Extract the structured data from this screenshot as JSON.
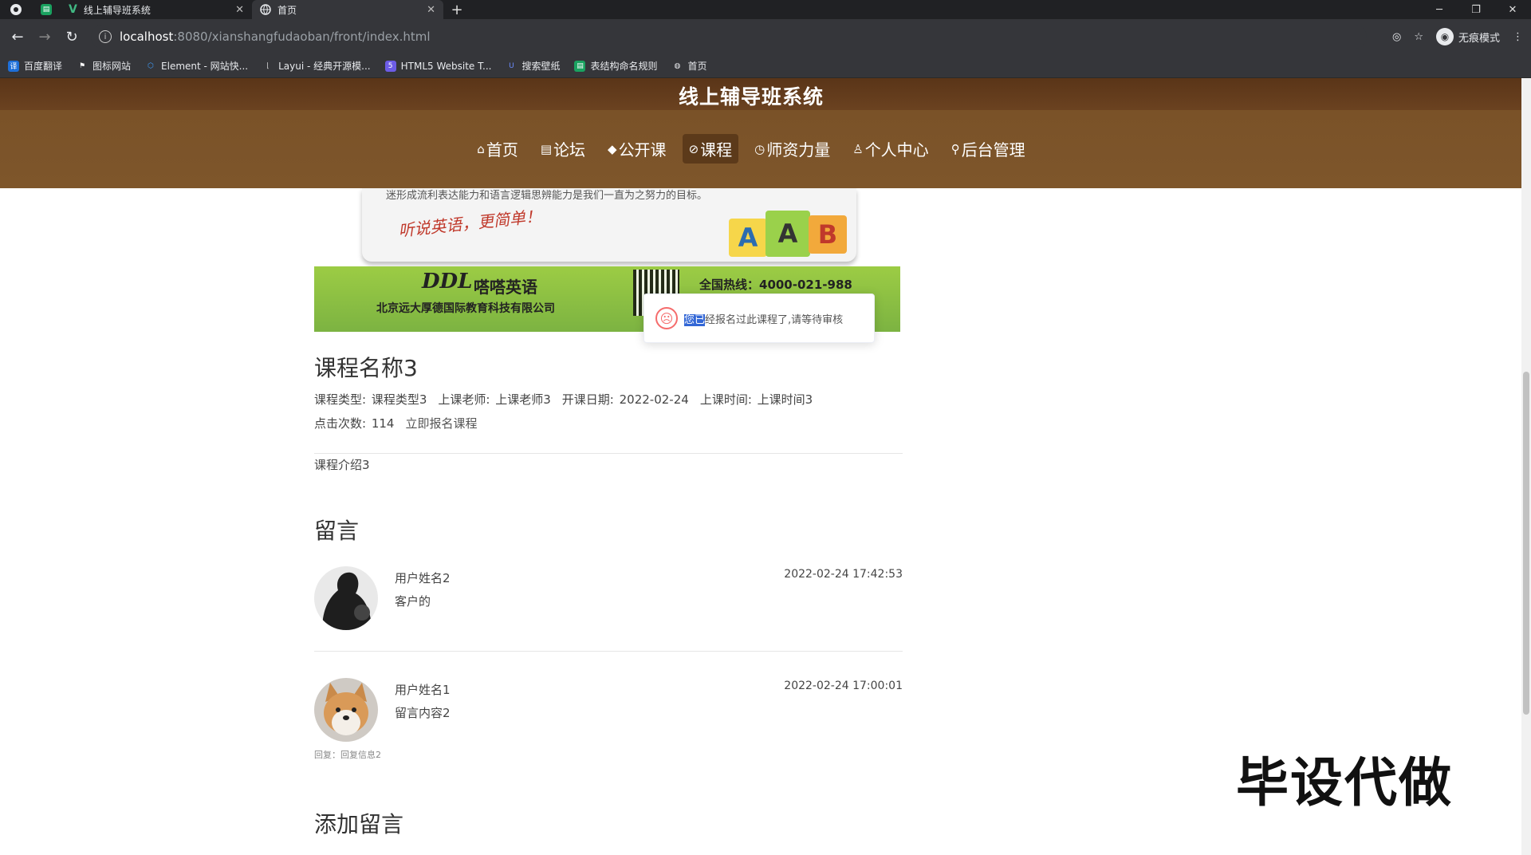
{
  "browser": {
    "tabs": [
      {
        "title": "线上辅导班系统",
        "active": false
      },
      {
        "title": "首页",
        "active": true
      }
    ],
    "url_host": "localhost",
    "url_path": ":8080/xianshangfudaoban/front/index.html",
    "incognito_label": "无痕模式",
    "bookmarks": [
      {
        "label": "百度翻译",
        "icon": "translate-icon",
        "color": "#1e6fd9"
      },
      {
        "label": "图标网站",
        "icon": "flag-icon",
        "color": "#333333"
      },
      {
        "label": "Element - 网站快...",
        "icon": "element-icon",
        "color": "#409eff"
      },
      {
        "label": "Layui - 经典开源模...",
        "icon": "layui-icon",
        "color": "#555555"
      },
      {
        "label": "HTML5 Website T...",
        "icon": "html5-icon",
        "color": "#6c5ce7"
      },
      {
        "label": "搜索壁纸",
        "icon": "wallpaper-icon",
        "color": "#2d5bd6"
      },
      {
        "label": "表结构命名规则",
        "icon": "sheet-icon",
        "color": "#1aa260"
      },
      {
        "label": "首页",
        "icon": "globe-icon",
        "color": "#888888"
      }
    ]
  },
  "site": {
    "title": "线上辅导班系统",
    "nav": [
      {
        "label": "首页",
        "icon": "home-icon",
        "active": false
      },
      {
        "label": "论坛",
        "icon": "forum-icon",
        "active": false
      },
      {
        "label": "公开课",
        "icon": "graduation-cap-icon",
        "active": false
      },
      {
        "label": "课程",
        "icon": "course-icon",
        "active": true
      },
      {
        "label": "师资力量",
        "icon": "power-icon",
        "active": false
      },
      {
        "label": "个人中心",
        "icon": "user-icon",
        "active": false
      },
      {
        "label": "后台管理",
        "icon": "link-icon",
        "active": false
      }
    ]
  },
  "banner": {
    "slogan_top": "迷形成流利表达能力和语言逻辑思辨能力是我们一直为之努力的目标。",
    "handwriting": "听说英语，更简单！",
    "blocks": [
      "A",
      "A",
      "B"
    ],
    "logo_letters": "DDL",
    "brand": "嗒嗒英语",
    "company": "北京远大厚德国际教育科技有限公司",
    "hotline": "全国热线：4000-021-988"
  },
  "toast": {
    "selected": "您已",
    "rest": "经报名过此课程了,请等待审核"
  },
  "course": {
    "name": "课程名称3",
    "type_label": "课程类型:",
    "type_value": "课程类型3",
    "teacher_label": "上课老师:",
    "teacher_value": "上课老师3",
    "start_label": "开课日期:",
    "start_value": "2022-02-24",
    "time_label": "上课时间:",
    "time_value": "上课时间3",
    "clicks_label": "点击次数:",
    "clicks_value": "114",
    "enroll_link": "立即报名课程",
    "intro": "课程介绍3"
  },
  "comments_title": "留言",
  "comments": [
    {
      "user": "用户姓名2",
      "text": "客户的",
      "time": "2022-02-24 17:42:53",
      "reply": ""
    },
    {
      "user": "用户姓名1",
      "text": "留言内容2",
      "time": "2022-02-24 17:00:01",
      "reply": "回复：回复信息2"
    }
  ],
  "add_comment_title": "添加留言",
  "watermark": "毕设代做"
}
